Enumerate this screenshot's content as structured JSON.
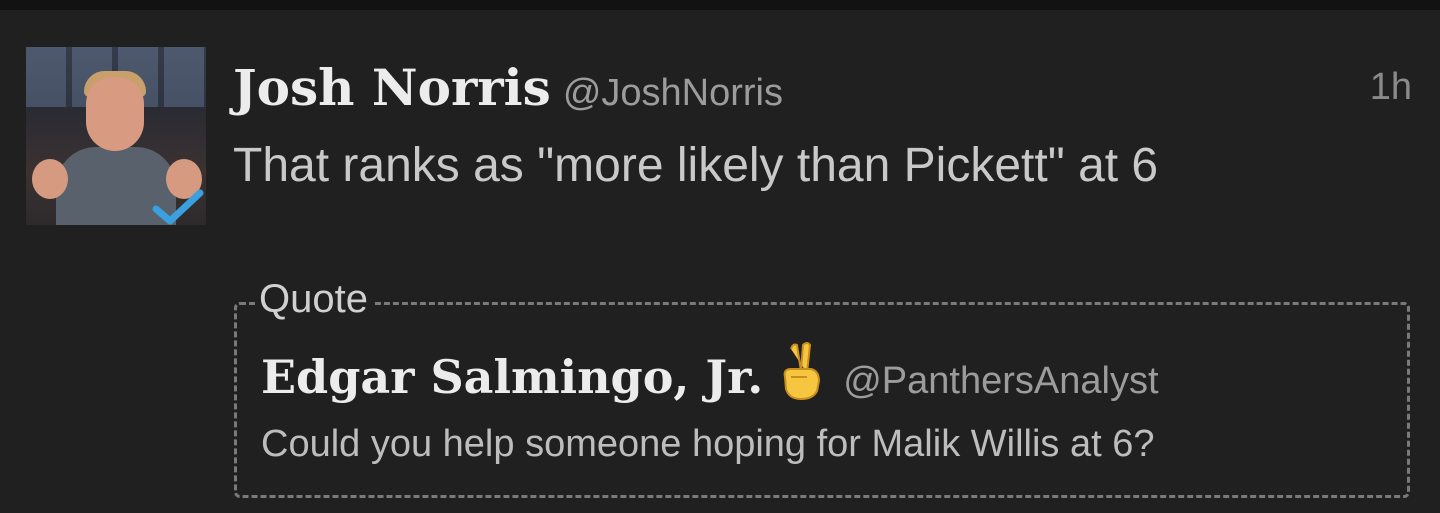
{
  "tweet": {
    "author": {
      "display_name": "Josh Norris",
      "handle": "@JoshNorris",
      "verified": true
    },
    "timestamp": "1h",
    "text": "That ranks as \"more likely than Pickett\" at 6",
    "quote": {
      "label": "Quote",
      "author": {
        "display_name": "Edgar Salmingo, Jr.",
        "emoji_icon": "victory-hand-icon",
        "handle": "@PanthersAnalyst"
      },
      "text": "Could you help someone hoping for Malik Willis at 6?"
    }
  },
  "colors": {
    "background": "#202020",
    "verified_check": "#3aa0e0"
  }
}
